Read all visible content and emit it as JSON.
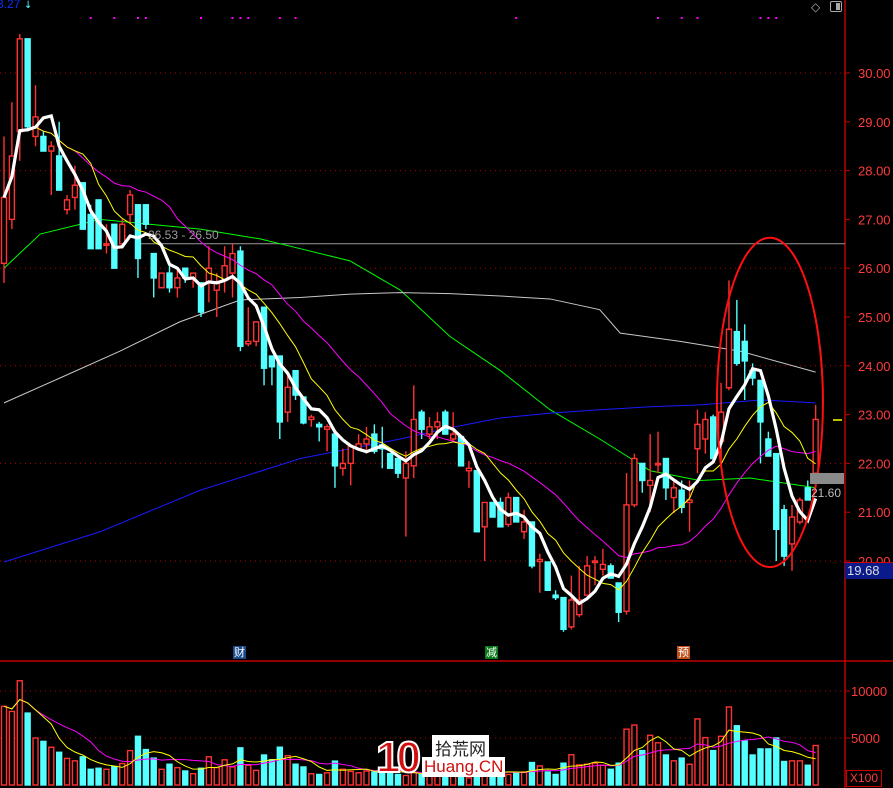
{
  "header": {
    "top_value": "3.27"
  },
  "icons": {
    "diamond": "diamond-icon",
    "panel": "panel-toggle-icon",
    "arrow": "down-arrow-icon"
  },
  "labels": {
    "range": "26.53 - 26.50",
    "last_price": "21.60",
    "current_price_box": "19.68",
    "volume_unit": "X100"
  },
  "markers": [
    {
      "text": "财",
      "color": "#1a4a8a"
    },
    {
      "text": "减",
      "color": "#0a7a1a"
    },
    {
      "text": "预",
      "color": "#c0501a"
    }
  ],
  "watermark": {
    "number": "10",
    "cn": "拾荒网",
    "en": "Huang.CN"
  },
  "colors": {
    "up": "#ff3232",
    "down": "#54ffff",
    "ma5": "#ffffff",
    "ma10": "#ffff00",
    "ma20": "#ff00ff",
    "ma60": "#00ff00",
    "ma120": "#c8c8c8",
    "ma250": "#1a1aff",
    "ellipse": "#ff1010"
  },
  "chart_data": {
    "type": "candlestick",
    "price_axis": {
      "min": 18.0,
      "max": 31.0,
      "ticks": [
        "30.00",
        "29.00",
        "28.00",
        "27.00",
        "26.00",
        "25.00",
        "24.00",
        "23.00",
        "22.00",
        "21.00",
        "20.00"
      ],
      "tick_values": [
        30,
        29,
        28,
        27,
        26,
        25,
        24,
        23,
        22,
        21,
        20
      ],
      "grid": [
        30,
        28,
        26,
        24,
        22,
        20
      ]
    },
    "volume_axis": {
      "ticks": [
        "10000",
        "5000"
      ],
      "tick_values": [
        10000,
        5000
      ],
      "unit": "X100"
    },
    "reference_line": {
      "value": 26.5,
      "from_index": 17
    },
    "candles": [
      [
        26.1,
        28.7,
        25.7,
        27.45
      ],
      [
        27.0,
        29.4,
        26.8,
        28.3
      ],
      [
        28.8,
        30.8,
        28.2,
        30.7
      ],
      [
        30.7,
        30.7,
        28.8,
        28.9
      ],
      [
        28.7,
        29.75,
        28.5,
        29.1
      ],
      [
        28.7,
        28.8,
        28.4,
        28.4
      ],
      [
        28.4,
        28.6,
        27.5,
        28.5
      ],
      [
        28.3,
        29.0,
        27.6,
        27.6
      ],
      [
        27.2,
        27.5,
        27.1,
        27.4
      ],
      [
        27.45,
        28.1,
        27.2,
        27.7
      ],
      [
        27.75,
        27.75,
        26.8,
        26.8
      ],
      [
        27.1,
        27.3,
        26.4,
        26.4
      ],
      [
        27.4,
        27.4,
        26.4,
        26.4
      ],
      [
        26.5,
        26.9,
        26.3,
        26.5
      ],
      [
        26.9,
        26.9,
        26.0,
        26.0
      ],
      [
        26.5,
        27.0,
        26.4,
        26.9
      ],
      [
        27.1,
        27.6,
        26.9,
        27.5
      ],
      [
        27.3,
        27.3,
        25.8,
        26.2
      ],
      [
        27.3,
        27.3,
        26.8,
        26.9
      ],
      [
        26.3,
        26.3,
        25.4,
        25.8
      ],
      [
        25.6,
        25.9,
        25.6,
        25.9
      ],
      [
        25.9,
        26.1,
        25.5,
        25.6
      ],
      [
        25.6,
        26.0,
        25.4,
        25.8
      ],
      [
        26.0,
        26.0,
        25.7,
        25.8
      ],
      [
        25.8,
        25.9,
        25.6,
        25.9
      ],
      [
        25.7,
        25.7,
        25.0,
        25.1
      ],
      [
        25.7,
        26.45,
        25.3,
        26.0
      ],
      [
        25.55,
        25.9,
        25.0,
        25.7
      ],
      [
        25.75,
        26.45,
        25.5,
        26.05
      ],
      [
        25.9,
        26.5,
        25.4,
        26.3
      ],
      [
        26.35,
        26.45,
        24.3,
        24.4
      ],
      [
        24.45,
        25.2,
        24.4,
        24.5
      ],
      [
        24.5,
        24.9,
        24.4,
        24.9
      ],
      [
        25.2,
        25.2,
        23.6,
        23.95
      ],
      [
        24.2,
        24.2,
        23.6,
        23.98
      ],
      [
        24.2,
        24.2,
        22.5,
        22.85
      ],
      [
        23.05,
        23.8,
        22.85,
        23.56
      ],
      [
        23.9,
        23.9,
        23.3,
        23.4
      ],
      [
        23.36,
        23.36,
        22.8,
        22.83
      ],
      [
        22.9,
        23.0,
        22.75,
        22.95
      ],
      [
        22.8,
        22.85,
        22.45,
        22.75
      ],
      [
        22.7,
        22.8,
        22.25,
        22.75
      ],
      [
        22.6,
        22.6,
        21.5,
        21.95
      ],
      [
        21.9,
        22.3,
        21.75,
        22.0
      ],
      [
        22.0,
        22.35,
        21.55,
        22.35
      ],
      [
        22.3,
        22.6,
        22.3,
        22.4
      ],
      [
        22.4,
        22.75,
        22.2,
        22.5
      ],
      [
        22.6,
        22.8,
        22.2,
        22.25
      ],
      [
        22.38,
        22.75,
        21.9,
        22.3
      ],
      [
        22.2,
        22.2,
        21.9,
        21.9
      ],
      [
        22.1,
        22.1,
        21.7,
        21.8
      ],
      [
        21.7,
        22.25,
        20.5,
        22.0
      ],
      [
        21.95,
        23.6,
        21.7,
        22.9
      ],
      [
        23.05,
        23.1,
        22.5,
        22.7
      ],
      [
        22.6,
        22.95,
        22.5,
        22.75
      ],
      [
        22.75,
        23.05,
        22.5,
        22.85
      ],
      [
        23.05,
        23.1,
        22.6,
        22.6
      ],
      [
        22.5,
        23.05,
        22.45,
        22.6
      ],
      [
        22.55,
        22.55,
        21.95,
        21.95
      ],
      [
        21.85,
        22.05,
        21.5,
        21.9
      ],
      [
        21.85,
        21.85,
        20.6,
        20.6
      ],
      [
        20.7,
        21.2,
        20.0,
        21.2
      ],
      [
        21.2,
        21.2,
        20.9,
        20.9
      ],
      [
        21.2,
        21.3,
        20.7,
        20.7
      ],
      [
        20.75,
        21.4,
        20.7,
        21.3
      ],
      [
        21.3,
        21.3,
        20.8,
        20.8
      ],
      [
        20.6,
        21.05,
        20.45,
        20.8
      ],
      [
        20.8,
        20.8,
        19.85,
        19.9
      ],
      [
        19.99,
        20.15,
        19.35,
        20.03
      ],
      [
        19.98,
        19.98,
        19.4,
        19.4
      ],
      [
        19.3,
        19.4,
        19.2,
        19.25
      ],
      [
        19.25,
        19.25,
        18.55,
        18.6
      ],
      [
        18.65,
        19.7,
        18.6,
        19.2
      ],
      [
        18.9,
        19.9,
        18.85,
        19.2
      ],
      [
        19.3,
        20.1,
        19.3,
        19.9
      ],
      [
        19.97,
        20.1,
        19.5,
        20.0
      ],
      [
        19.83,
        20.25,
        19.7,
        19.93
      ],
      [
        19.9,
        19.95,
        19.65,
        19.65
      ],
      [
        19.55,
        19.55,
        18.75,
        18.95
      ],
      [
        18.97,
        21.8,
        18.9,
        21.15
      ],
      [
        21.15,
        22.2,
        21.1,
        22.1
      ],
      [
        22.0,
        22.0,
        21.4,
        21.65
      ],
      [
        21.55,
        22.6,
        21.0,
        21.65
      ],
      [
        21.97,
        22.65,
        21.8,
        22.0
      ],
      [
        22.1,
        22.1,
        21.25,
        21.5
      ],
      [
        21.3,
        21.7,
        20.98,
        21.5
      ],
      [
        21.45,
        21.65,
        20.98,
        21.1
      ],
      [
        21.2,
        21.65,
        20.6,
        21.25
      ],
      [
        22.3,
        23.1,
        21.8,
        22.8
      ],
      [
        22.5,
        23.05,
        22.2,
        22.9
      ],
      [
        22.95,
        23.0,
        22.05,
        22.1
      ],
      [
        22.45,
        23.65,
        22.0,
        23.05
      ],
      [
        23.55,
        25.75,
        23.5,
        24.75
      ],
      [
        24.7,
        25.35,
        24.0,
        24.05
      ],
      [
        24.5,
        24.85,
        23.3,
        24.1
      ],
      [
        23.9,
        24.05,
        23.6,
        23.75
      ],
      [
        23.7,
        23.7,
        22.0,
        22.85
      ],
      [
        22.5,
        22.65,
        22.15,
        22.15
      ],
      [
        22.2,
        22.2,
        20.0,
        20.65
      ],
      [
        21.05,
        21.15,
        19.9,
        20.1
      ],
      [
        20.35,
        21.15,
        19.8,
        20.9
      ],
      [
        20.8,
        21.3,
        20.75,
        21.25
      ],
      [
        21.5,
        21.65,
        21.25,
        21.25
      ],
      [
        21.8,
        23.2,
        21.8,
        22.9
      ]
    ],
    "volumes": [
      8370,
      7830,
      11090,
      7650,
      5000,
      4640,
      4020,
      3480,
      2830,
      2570,
      3000,
      1670,
      1780,
      1670,
      1960,
      2280,
      3660,
      5180,
      3770,
      2860,
      1670,
      2210,
      1850,
      1490,
      1200,
      1780,
      3000,
      1850,
      2680,
      1920,
      3950,
      2100,
      1560,
      3190,
      2680,
      4020,
      3120,
      2210,
      1920,
      1200,
      1120,
      1300,
      2540,
      1670,
      1450,
      1300,
      1490,
      1380,
      1740,
      1490,
      1120,
      1010,
      1300,
      1120,
      1120,
      1490,
      1490,
      1380,
      1490,
      760,
      1380,
      1490,
      1590,
      1410,
      1120,
      1300,
      1380,
      2390,
      2030,
      1380,
      1120,
      2320,
      3220,
      2140,
      2210,
      2320,
      2100,
      1670,
      2320,
      5940,
      6380,
      3660,
      5290,
      4490,
      3190,
      2570,
      2860,
      2210,
      7030,
      5040,
      3660,
      5180,
      8300,
      6300,
      4670,
      3190,
      3840,
      3840,
      5000,
      2500,
      2570,
      2570,
      2100,
      4200
    ],
    "computed_ma": [
      {
        "name": "MA5",
        "period": 5
      },
      {
        "name": "MA10",
        "period": 10
      },
      {
        "name": "MA20",
        "period": 20
      }
    ],
    "long_ma": [
      {
        "name": "MA60",
        "points": [
          [
            0,
            26.0
          ],
          [
            4.6,
            26.7
          ],
          [
            12.2,
            27.0
          ],
          [
            18.5,
            26.9
          ],
          [
            24.9,
            26.8
          ],
          [
            32.5,
            26.6
          ],
          [
            37.6,
            26.4
          ],
          [
            43.9,
            26.15
          ],
          [
            50.3,
            25.55
          ],
          [
            56.6,
            24.6
          ],
          [
            63,
            23.9
          ],
          [
            69.3,
            23.1
          ],
          [
            75.6,
            22.5
          ],
          [
            82,
            21.85
          ],
          [
            88.3,
            21.65
          ],
          [
            94.7,
            21.7
          ],
          [
            103,
            21.5
          ]
        ]
      },
      {
        "name": "MA120",
        "points": [
          [
            0,
            23.24
          ],
          [
            7.1,
            23.75
          ],
          [
            14.7,
            24.3
          ],
          [
            22.3,
            24.9
          ],
          [
            30,
            25.35
          ],
          [
            37.6,
            25.4
          ],
          [
            43.9,
            25.47
          ],
          [
            50.3,
            25.5
          ],
          [
            56.6,
            25.48
          ],
          [
            63,
            25.43
          ],
          [
            69.3,
            25.37
          ],
          [
            75.6,
            25.15
          ],
          [
            78.2,
            24.67
          ],
          [
            85.8,
            24.5
          ],
          [
            93.4,
            24.3
          ],
          [
            103,
            23.87
          ]
        ]
      },
      {
        "name": "MA250",
        "points": [
          [
            0,
            19.98
          ],
          [
            12.2,
            20.6
          ],
          [
            24.9,
            21.45
          ],
          [
            37.6,
            22.1
          ],
          [
            43.9,
            22.3
          ],
          [
            50.3,
            22.5
          ],
          [
            56.6,
            22.73
          ],
          [
            63,
            22.93
          ],
          [
            69.3,
            23.03
          ],
          [
            75.6,
            23.1
          ],
          [
            82,
            23.16
          ],
          [
            88.3,
            23.2
          ],
          [
            96,
            23.3
          ],
          [
            103,
            23.24
          ]
        ]
      }
    ],
    "event_dot_indices": [
      11,
      14,
      17,
      18,
      25,
      29,
      30,
      31,
      35,
      37,
      65,
      83,
      86,
      88,
      96,
      97,
      98
    ],
    "highlight_ellipse": {
      "center_index": 97.2,
      "center_price": 23.25,
      "price_span": [
        19.85,
        26.6
      ]
    }
  }
}
